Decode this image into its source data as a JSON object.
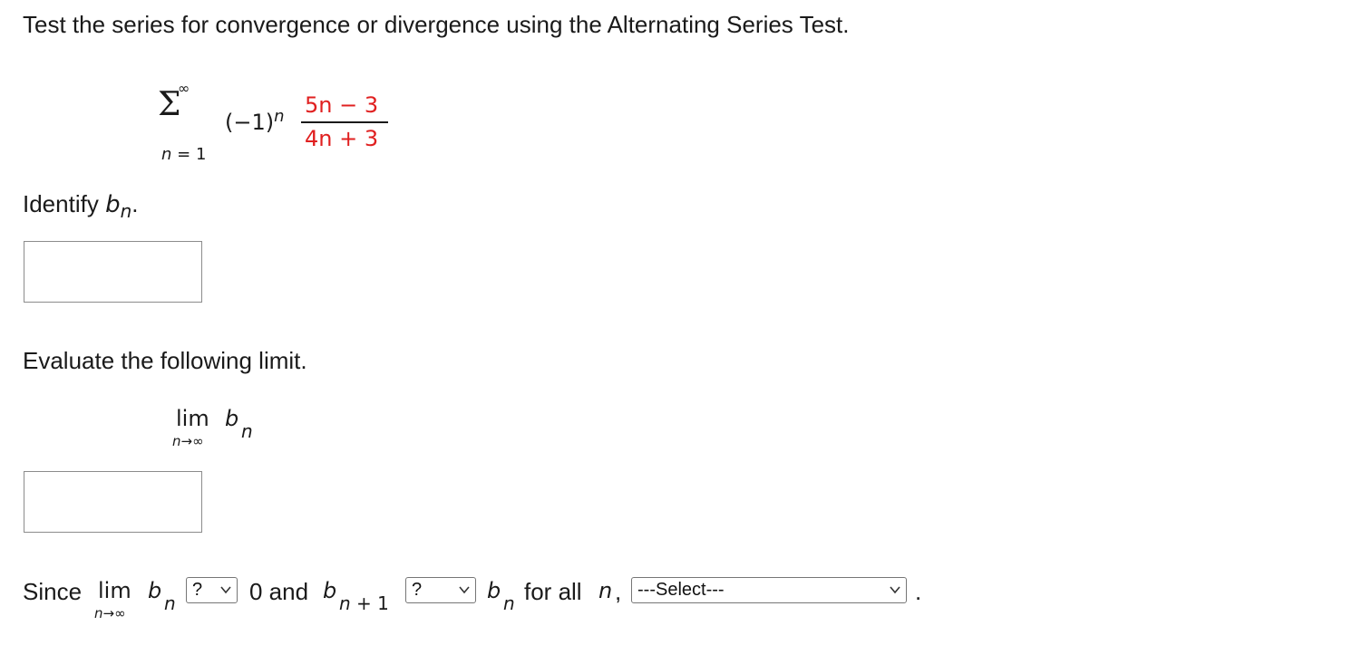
{
  "instruction": "Test the series for convergence or divergence using the Alternating Series Test.",
  "series": {
    "sum_upper": "∞",
    "sum_symbol": "Σ",
    "sum_lower": "n = 1",
    "factor_base": "(−1)",
    "factor_exp": "n",
    "numerator": "5n − 3",
    "denominator": "4n + 3"
  },
  "identify": {
    "prefix": "Identify ",
    "var": "b",
    "sub": "n",
    "suffix": "."
  },
  "bn_answer": {
    "value": ""
  },
  "evaluate": {
    "label": "Evaluate the following limit.",
    "lim": "lim",
    "lim_sub": "n→∞",
    "var": "b",
    "sub": "n"
  },
  "limit_answer": {
    "value": ""
  },
  "conclusion": {
    "since": "Since",
    "lim": "lim",
    "lim_sub": "n→∞",
    "var": "b",
    "sub": "n",
    "select1_value": "?",
    "text_and": "0 and",
    "var2": "b",
    "sub2": "n + 1",
    "select2_value": "?",
    "var3": "b",
    "sub3": "n",
    "text_forall": "for all",
    "var4": "n",
    "comma": ",",
    "select3_value": "---Select---",
    "period": "."
  },
  "colors": {
    "accent_red": "#e02020",
    "text": "#1a1a1a",
    "border": "#8c8c8c"
  }
}
